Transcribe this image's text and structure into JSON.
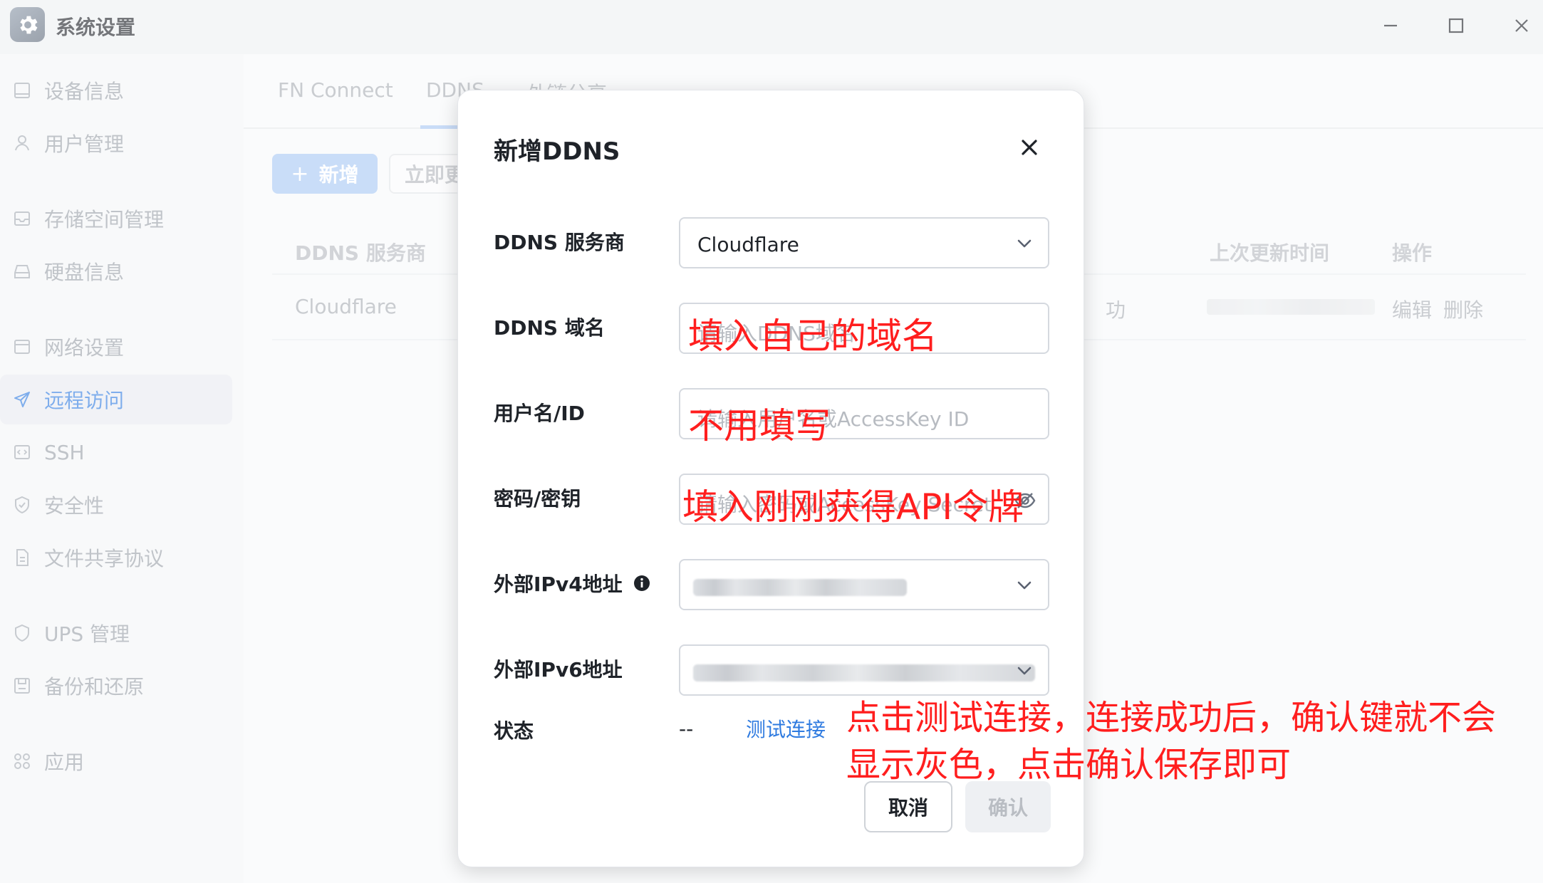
{
  "window": {
    "title": "系统设置"
  },
  "sidebar": {
    "items": [
      {
        "label": "设备信息",
        "icon": "device-info-icon"
      },
      {
        "label": "用户管理",
        "icon": "user-icon"
      },
      {
        "label": "存储空间管理",
        "icon": "storage-icon"
      },
      {
        "label": "硬盘信息",
        "icon": "disk-icon"
      },
      {
        "label": "网络设置",
        "icon": "network-icon"
      },
      {
        "label": "远程访问",
        "icon": "send-icon",
        "active": true
      },
      {
        "label": "SSH",
        "icon": "code-icon"
      },
      {
        "label": "安全性",
        "icon": "shield-check-icon"
      },
      {
        "label": "文件共享协议",
        "icon": "file-icon"
      },
      {
        "label": "UPS 管理",
        "icon": "shield-icon"
      },
      {
        "label": "备份和还原",
        "icon": "backup-icon"
      },
      {
        "label": "应用",
        "icon": "apps-icon"
      }
    ]
  },
  "tabs": {
    "items": [
      "FN Connect",
      "DDNS",
      "外链分享"
    ],
    "active": "DDNS"
  },
  "toolbar": {
    "add_label": "新增",
    "refresh_label": "立即更新"
  },
  "table": {
    "headers": {
      "provider": "DDNS 服务商",
      "last_update": "上次更新时间",
      "actions": "操作"
    },
    "row": {
      "provider": "Cloudflare",
      "status_fragment": "功",
      "edit": "编辑",
      "delete": "删除"
    }
  },
  "modal": {
    "title": "新增DDNS",
    "fields": {
      "provider": {
        "label": "DDNS 服务商",
        "value": "Cloudflare"
      },
      "domain": {
        "label": "DDNS 域名",
        "placeholder": "请输入DDNS域名"
      },
      "username": {
        "label": "用户名/ID",
        "placeholder": "请输入用户名或AccessKey ID"
      },
      "password": {
        "label": "密码/密钥",
        "placeholder": "请输入密码或AccessKey Secret"
      },
      "ipv4": {
        "label": "外部IPv4地址"
      },
      "ipv6": {
        "label": "外部IPv6地址"
      },
      "status": {
        "label": "状态",
        "value": "--"
      }
    },
    "test_link": "测试连接",
    "cancel_label": "取消",
    "confirm_label": "确认"
  },
  "annotations": {
    "domain_note": "填入自己的域名",
    "username_note": "不用填写",
    "password_note": "填入刚刚获得API令牌",
    "instruction_line1": "点击测试连接，连接成功后，确认键就不会",
    "instruction_line2": "显示灰色，点击确认保存即可",
    "color": "#ff1e1e"
  },
  "colors": {
    "accent": "#2f7be0",
    "annotation": "#ff1e1e"
  }
}
